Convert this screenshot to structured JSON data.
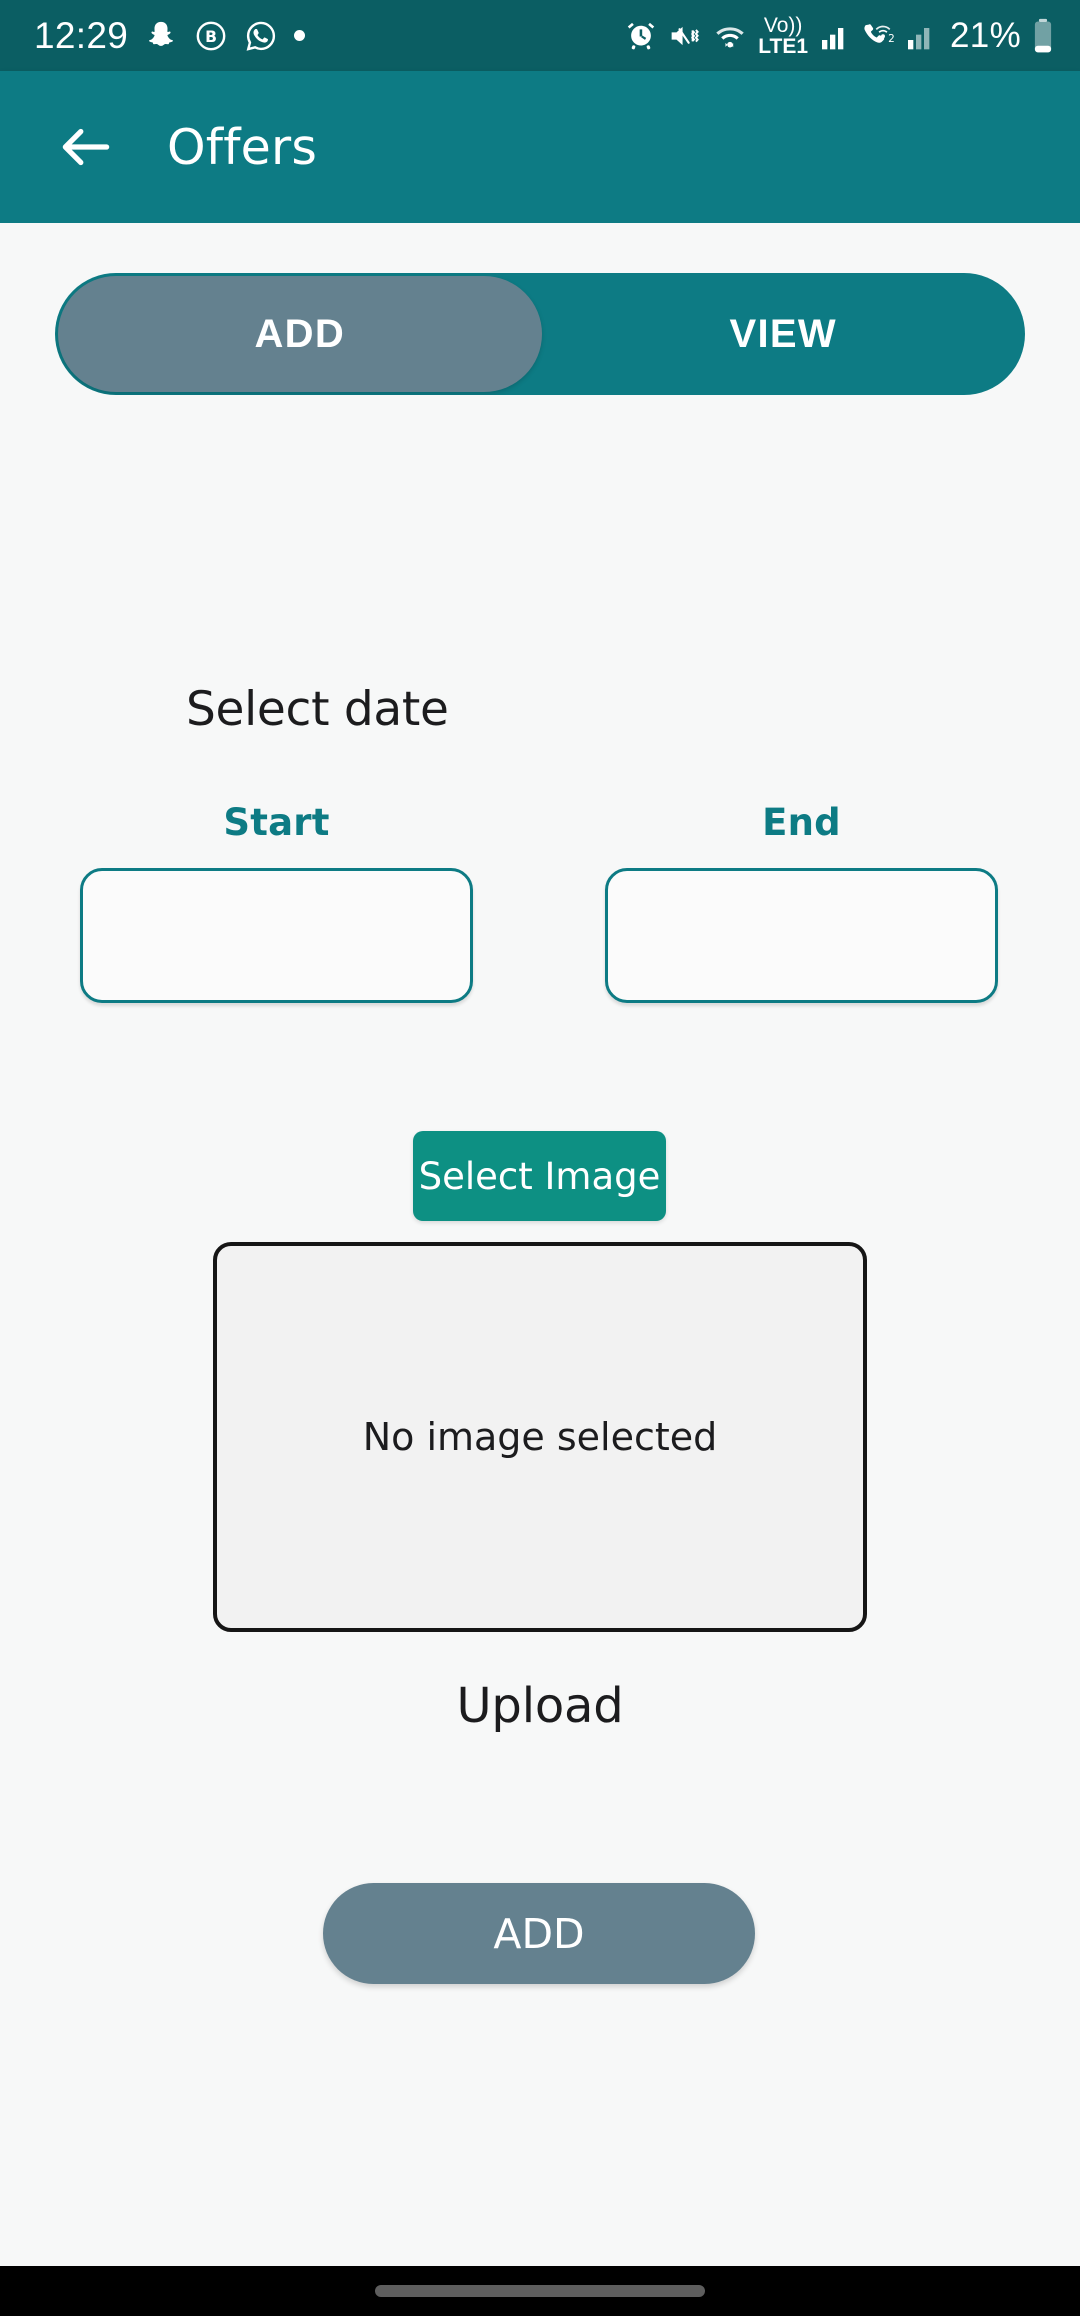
{
  "status_bar": {
    "time": "12:29",
    "battery_percent": "21%",
    "network_label": "LTE1",
    "volte_label": "Vo))",
    "sim2_label": "2",
    "left_icons": [
      "snapchat-icon",
      "b-circle-icon",
      "whatsapp-icon",
      "dot-icon"
    ],
    "right_icons": [
      "alarm-icon",
      "mute-vibrate-icon",
      "wifi-icon",
      "volte-signal-icon",
      "signal-bars-icon",
      "call-wifi-icon",
      "signal-bars-2-icon",
      "battery-icon"
    ],
    "background_color": "#0b5e63"
  },
  "app_bar": {
    "title": "Offers",
    "back_icon": "arrow-left-icon",
    "background_color": "#0d7b84"
  },
  "tabs": {
    "items": [
      {
        "label": "ADD",
        "selected": true
      },
      {
        "label": "VIEW",
        "selected": false
      }
    ],
    "track_color": "#0d7b84",
    "selected_color": "#64818f"
  },
  "form": {
    "section_heading": "Select date",
    "start": {
      "label": "Start",
      "value": "",
      "placeholder": ""
    },
    "end": {
      "label": "End",
      "value": "",
      "placeholder": ""
    },
    "select_image_label": "Select Image",
    "image_placeholder_text": "No image selected",
    "upload_label": "Upload",
    "submit_label": "ADD",
    "accent_color": "#0d7b84",
    "select_image_color": "#0d9083",
    "submit_color": "#64818f"
  },
  "nav_bar": {
    "gesture_pill": "home-gesture-pill",
    "background_color": "#000000"
  }
}
